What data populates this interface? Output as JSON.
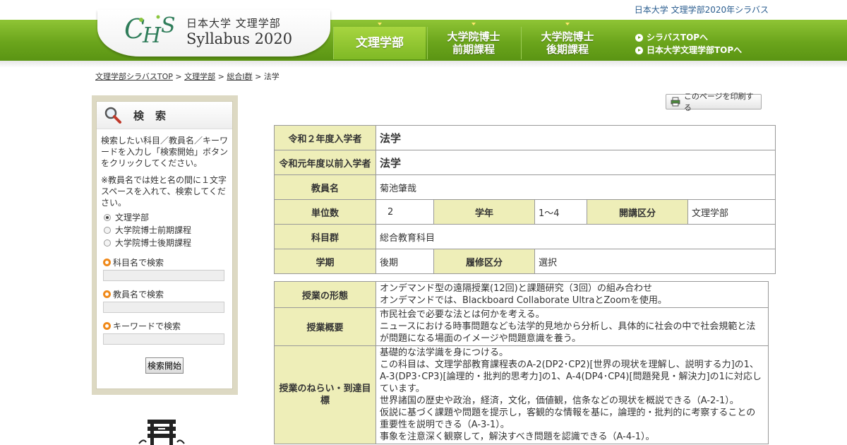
{
  "topbar": {
    "link": "日本大学 文理学部2020年シラバス"
  },
  "logo": {
    "mark": "CHS",
    "jp": "日本大学 文理学部",
    "en": "Syllabus 2020"
  },
  "nav": {
    "tabs": [
      {
        "label": "文理学部"
      },
      {
        "label_l1": "大学院博士",
        "label_l2": "前期課程"
      },
      {
        "label_l1": "大学院博士",
        "label_l2": "後期課程"
      }
    ],
    "links": [
      "シラバスTOPへ",
      "日本大学文理学部TOPへ"
    ]
  },
  "breadcrumb": {
    "items": [
      "文理学部シラバスTOP",
      "文理学部",
      "総合Ⅰ群"
    ],
    "current": "法学",
    "sep": ">"
  },
  "sidebar": {
    "title": "検索",
    "instructions": "検索したい科目／教員名／キーワードを入力し「検索開始」ボタンをクリックしてください。",
    "note": "※教員名では姓と名の間に１文字スペースを入れて、検索してください。",
    "radios": [
      "文理学部",
      "大学院博士前期課程",
      "大学院博士後期課程"
    ],
    "fields": [
      "科目名で検索",
      "教員名で検索",
      "キーワードで検索"
    ],
    "button": "検索開始"
  },
  "print_button": "このページを印刷する",
  "course": {
    "labels": {
      "reiwa2": "令和２年度入学者",
      "reiwa1": "令和元年度以前入学者",
      "teacher": "教員名",
      "credits": "単位数",
      "year": "学年",
      "division": "開講区分",
      "group": "科目群",
      "term": "学期",
      "req": "履修区分"
    },
    "reiwa2": "法学",
    "reiwa1": "法学",
    "teacher": "菊池肇哉",
    "credits": "2",
    "year": "1～4",
    "division": "文理学部",
    "group": "総合教育科目",
    "term": "後期",
    "req": "選択"
  },
  "details": {
    "format_label": "授業の形態",
    "format": [
      "オンデマンド型の遠隔授業(12回)と課題研究（3回）の組み合わせ",
      "オンデマンドでは、Blackboard Collaborate UltraとZoomを使用。"
    ],
    "overview_label": "授業概要",
    "overview": [
      "市民社会で必要な法とは何かを考える。",
      "ニュースにおける時事問題なども法学的見地から分析し、具体的に社会の中で社会規範と法が問題になる場面のイメージや問題意識を養う。"
    ],
    "goals_label": "授業のねらい・到達目標",
    "goals": [
      "基礎的な法学識を身につける。",
      "この科目は、文理学部教育課程表のA-2(DP2･CP2)[世界の現状を理解し、説明する力]の1、A-3(DP3･CP3)[論理的・批判的思考力]の1、A-4(DP4･CP4)[問題発見・解決力]の1に対応しています。",
      "世界諸国の歴史や政治，経済，文化，価値観，信条などの現状を概説できる（A-2-1）。",
      "仮説に基づく課題や問題を提示し，客観的な情報を基に，論理的・批判的に考察することの重要性を説明できる（A-3-1）。",
      "事象を注意深く観察して，解決すべき問題を認識できる（A-4-1）。"
    ]
  }
}
